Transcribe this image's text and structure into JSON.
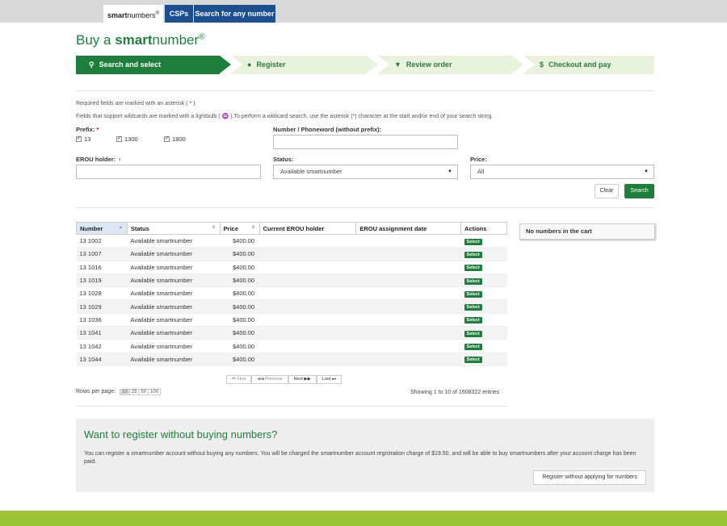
{
  "topnav": {
    "brand_prefix": "smart",
    "brand_suffix": "numbers",
    "brand_mark": "®",
    "tab_csps": "CSPs",
    "tab_search": "Search for any number"
  },
  "title": {
    "prefix": "Buy a ",
    "bold": "smart",
    "suffix": "number",
    "mark": "®"
  },
  "steps": [
    {
      "icon": "search-icon",
      "glyph": "🔍",
      "label": "Search and select",
      "active": true
    },
    {
      "icon": "user-icon",
      "glyph": "👤",
      "label": "Register",
      "active": false
    },
    {
      "icon": "cart-icon",
      "glyph": "🛒",
      "label": "Review order",
      "active": false
    },
    {
      "icon": "dollar-icon",
      "glyph": "$",
      "label": "Checkout and pay",
      "active": false
    }
  ],
  "notes": {
    "required_pre": "Required fields are marked with an asterisk (",
    "required_star": "*",
    "required_post": ").",
    "wildcard": "Fields that support wildcards are marked with a lightbulb ( ♒ ).To perform a wildcard search, use the asterisk (*) character at the start and/or end of your search string."
  },
  "form": {
    "prefix_label": "Prefix:",
    "prefix_options": [
      "13",
      "1300",
      "1800"
    ],
    "number_label": "Number / Phoneword (without prefix):",
    "number_value": "",
    "erou_label": "EROU holder:",
    "erou_value": "",
    "status_label": "Status:",
    "status_value": "Available smartnumber",
    "price_label": "Price:",
    "price_value": "All",
    "clear_label": "Clear",
    "search_label": "Search"
  },
  "table": {
    "headers": [
      "Number",
      "Status",
      "Price",
      "Current EROU holder",
      "EROU assignment date",
      "Actions"
    ],
    "rows": [
      {
        "number": "13 1002",
        "status": "Available smartnumber",
        "price": "$400.00",
        "holder": "",
        "date": "",
        "action": "Select"
      },
      {
        "number": "13 1007",
        "status": "Available smartnumber",
        "price": "$400.00",
        "holder": "",
        "date": "",
        "action": "Select"
      },
      {
        "number": "13 1016",
        "status": "Available smartnumber",
        "price": "$400.00",
        "holder": "",
        "date": "",
        "action": "Select"
      },
      {
        "number": "13 1019",
        "status": "Available smartnumber",
        "price": "$400.00",
        "holder": "",
        "date": "",
        "action": "Select"
      },
      {
        "number": "13 1028",
        "status": "Available smartnumber",
        "price": "$400.00",
        "holder": "",
        "date": "",
        "action": "Select"
      },
      {
        "number": "13 1029",
        "status": "Available smartnumber",
        "price": "$400.00",
        "holder": "",
        "date": "",
        "action": "Select"
      },
      {
        "number": "13 1036",
        "status": "Available smartnumber",
        "price": "$400.00",
        "holder": "",
        "date": "",
        "action": "Select"
      },
      {
        "number": "13 1041",
        "status": "Available smartnumber",
        "price": "$400.00",
        "holder": "",
        "date": "",
        "action": "Select"
      },
      {
        "number": "13 1042",
        "status": "Available smartnumber",
        "price": "$400.00",
        "holder": "",
        "date": "",
        "action": "Select"
      },
      {
        "number": "13 1044",
        "status": "Available smartnumber",
        "price": "$400.00",
        "holder": "",
        "date": "",
        "action": "Select"
      }
    ]
  },
  "cart": {
    "label": "No numbers in the cart"
  },
  "pager": {
    "first": "⏮ First",
    "previous": "◀◀ Previous",
    "next": "Next ▶▶",
    "last": "Last ⏭"
  },
  "rows_per_page": {
    "label": "Rows per page:",
    "options": [
      "10",
      "25",
      "50",
      "100"
    ],
    "selected": "10"
  },
  "showing": "Showing 1 to 10 of 1608322 entries",
  "register": {
    "heading": "Want to register without buying numbers?",
    "text": "You can register a smartnumber account without buying any numbers. You will be charged the smartnumber account registration charge of $19.50, and will be able to buy smartnumbers after your account charge has been paid.",
    "button": "Register without applying for numbers"
  },
  "colors": {
    "brand_green": "#1e7f3c",
    "light_green": "#e8f2dc",
    "nav_blue": "#1b4f8f",
    "footer_green": "#9ac335"
  }
}
